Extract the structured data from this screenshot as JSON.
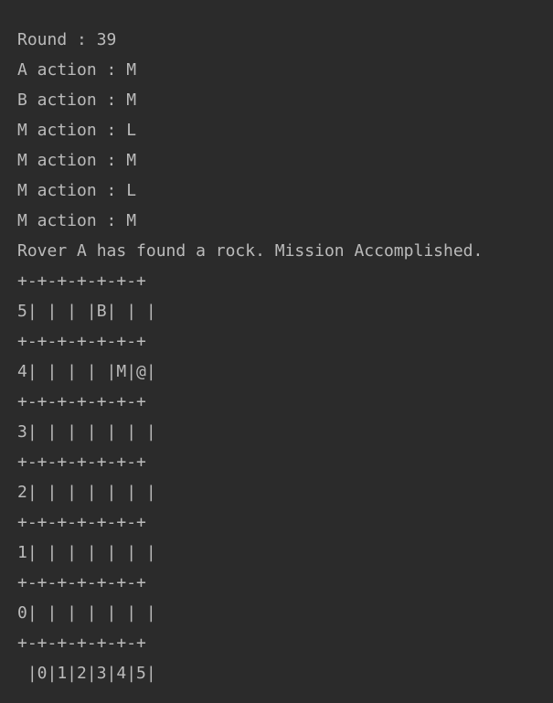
{
  "console": {
    "lines": [
      "Round : 39",
      "A action : M",
      "B action : M",
      "M action : L",
      "M action : M",
      "M action : L",
      "M action : M",
      "Rover A has found a rock. Mission Accomplished.",
      "+-+-+-+-+-+-+",
      "5| | | |B| | |",
      "+-+-+-+-+-+-+",
      "4| | | | |M|@|",
      "+-+-+-+-+-+-+",
      "3| | | | | | |",
      "+-+-+-+-+-+-+",
      "2| | | | | | |",
      "+-+-+-+-+-+-+",
      "1| | | | | | |",
      "+-+-+-+-+-+-+",
      "0| | | | | | |",
      "+-+-+-+-+-+-+",
      " |0|1|2|3|4|5|"
    ]
  }
}
